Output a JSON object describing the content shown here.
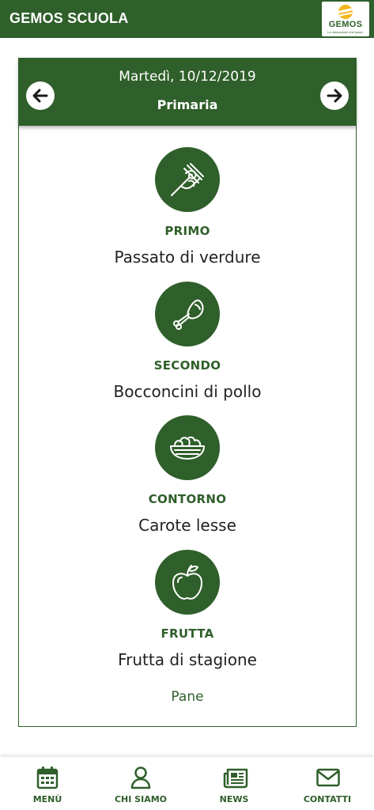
{
  "app": {
    "title": "GEMOS SCUOLA",
    "logo_text": "GEMOS",
    "logo_tagline": "La ristorazione che piace."
  },
  "menu": {
    "date": "Martedì, 10/12/2019",
    "school": "Primaria",
    "courses": [
      {
        "label": "PRIMO",
        "dish": "Passato di verdure",
        "icon": "pasta-fork-icon"
      },
      {
        "label": "SECONDO",
        "dish": "Bocconcini di pollo",
        "icon": "chicken-leg-icon"
      },
      {
        "label": "CONTORNO",
        "dish": "Carote lesse",
        "icon": "salad-bowl-icon"
      },
      {
        "label": "FRUTTA",
        "dish": "Frutta di stagione",
        "icon": "apple-icon"
      }
    ],
    "extra": "Pane"
  },
  "bottom_nav": [
    {
      "label": "MENÙ",
      "icon": "calendar-icon"
    },
    {
      "label": "CHI SIAMO",
      "icon": "user-icon"
    },
    {
      "label": "NEWS",
      "icon": "newspaper-icon"
    },
    {
      "label": "CONTATTI",
      "icon": "envelope-icon"
    }
  ],
  "colors": {
    "primary": "#2f5f2a",
    "accent": "#f3b71c",
    "background": "#ffffff"
  }
}
